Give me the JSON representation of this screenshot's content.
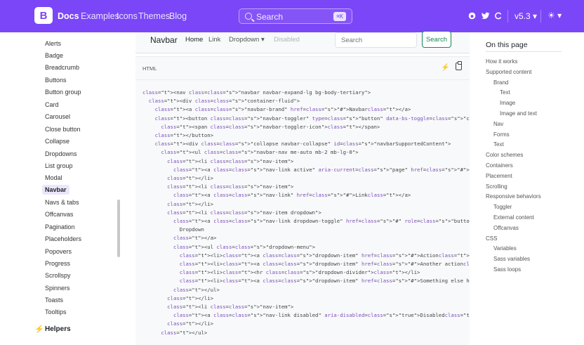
{
  "topbar": {
    "brand_logo": "B",
    "links": [
      "Docs",
      "Examples",
      "Icons",
      "Themes",
      "Blog"
    ],
    "search_placeholder": "Search",
    "search_shortcut": "⌘K",
    "github_icon": "github-icon",
    "twitter_icon": "twitter-icon",
    "opencollective_icon": "opencollective-icon",
    "version": "v5.3",
    "theme_icon": "☀",
    "colors": {
      "bg": "#7b46f7"
    }
  },
  "sidebar": {
    "items": [
      "Alerts",
      "Badge",
      "Breadcrumb",
      "Buttons",
      "Button group",
      "Card",
      "Carousel",
      "Close button",
      "Collapse",
      "Dropdowns",
      "List group",
      "Modal",
      "Navbar",
      "Navs & tabs",
      "Offcanvas",
      "Pagination",
      "Placeholders",
      "Popovers",
      "Progress",
      "Scrollspy",
      "Spinners",
      "Toasts",
      "Tooltips"
    ],
    "active": "Navbar",
    "section": "Helpers"
  },
  "example": {
    "brand": "Navbar",
    "links": [
      "Home",
      "Link",
      "Dropdown ▾",
      "Disabled"
    ],
    "search_placeholder": "Search",
    "search_button": "Search"
  },
  "code": {
    "lang": "HTML",
    "lines": [
      "<nav class=\"navbar navbar-expand-lg bg-body-tertiary\">",
      "  <div class=\"container-fluid\">",
      "    <a class=\"navbar-brand\" href=\"#\">Navbar</a>",
      "    <button class=\"navbar-toggler\" type=\"button\" data-bs-toggle=\"collapse\" data-bs-ta",
      "      <span class=\"navbar-toggler-icon\"></span>",
      "    </button>",
      "    <div class=\"collapse navbar-collapse\" id=\"navbarSupportedContent\">",
      "      <ul class=\"navbar-nav me-auto mb-2 mb-lg-0\">",
      "        <li class=\"nav-item\">",
      "          <a class=\"nav-link active\" aria-current=\"page\" href=\"#\">Home</a>",
      "        </li>",
      "        <li class=\"nav-item\">",
      "          <a class=\"nav-link\" href=\"#\">Link</a>",
      "        </li>",
      "        <li class=\"nav-item dropdown\">",
      "          <a class=\"nav-link dropdown-toggle\" href=\"#\" role=\"button\" data-bs-toggle='",
      "            Dropdown",
      "          </a>",
      "          <ul class=\"dropdown-menu\">",
      "            <li><a class=\"dropdown-item\" href=\"#\">Action</a></li>",
      "            <li><a class=\"dropdown-item\" href=\"#\">Another action</a></li>",
      "            <li><hr class=\"dropdown-divider\"></li>",
      "            <li><a class=\"dropdown-item\" href=\"#\">Something else here</a></li>",
      "          </ul>",
      "        </li>",
      "        <li class=\"nav-item\">",
      "          <a class=\"nav-link disabled\" aria-disabled=\"true\">Disabled</a>",
      "        </li>",
      "      </ul>"
    ]
  },
  "toc": {
    "title": "On this page",
    "items": [
      {
        "label": "How it works",
        "level": 0
      },
      {
        "label": "Supported content",
        "level": 0
      },
      {
        "label": "Brand",
        "level": 1
      },
      {
        "label": "Text",
        "level": 2
      },
      {
        "label": "Image",
        "level": 2
      },
      {
        "label": "Image and text",
        "level": 2
      },
      {
        "label": "Nav",
        "level": 1
      },
      {
        "label": "Forms",
        "level": 1
      },
      {
        "label": "Text",
        "level": 1
      },
      {
        "label": "Color schemes",
        "level": 0
      },
      {
        "label": "Containers",
        "level": 0
      },
      {
        "label": "Placement",
        "level": 0
      },
      {
        "label": "Scrolling",
        "level": 0
      },
      {
        "label": "Responsive behaviors",
        "level": 0
      },
      {
        "label": "Toggler",
        "level": 1
      },
      {
        "label": "External content",
        "level": 1
      },
      {
        "label": "Offcanvas",
        "level": 1
      },
      {
        "label": "CSS",
        "level": 0
      },
      {
        "label": "Variables",
        "level": 1
      },
      {
        "label": "Sass variables",
        "level": 1
      },
      {
        "label": "Sass loops",
        "level": 1
      }
    ]
  }
}
